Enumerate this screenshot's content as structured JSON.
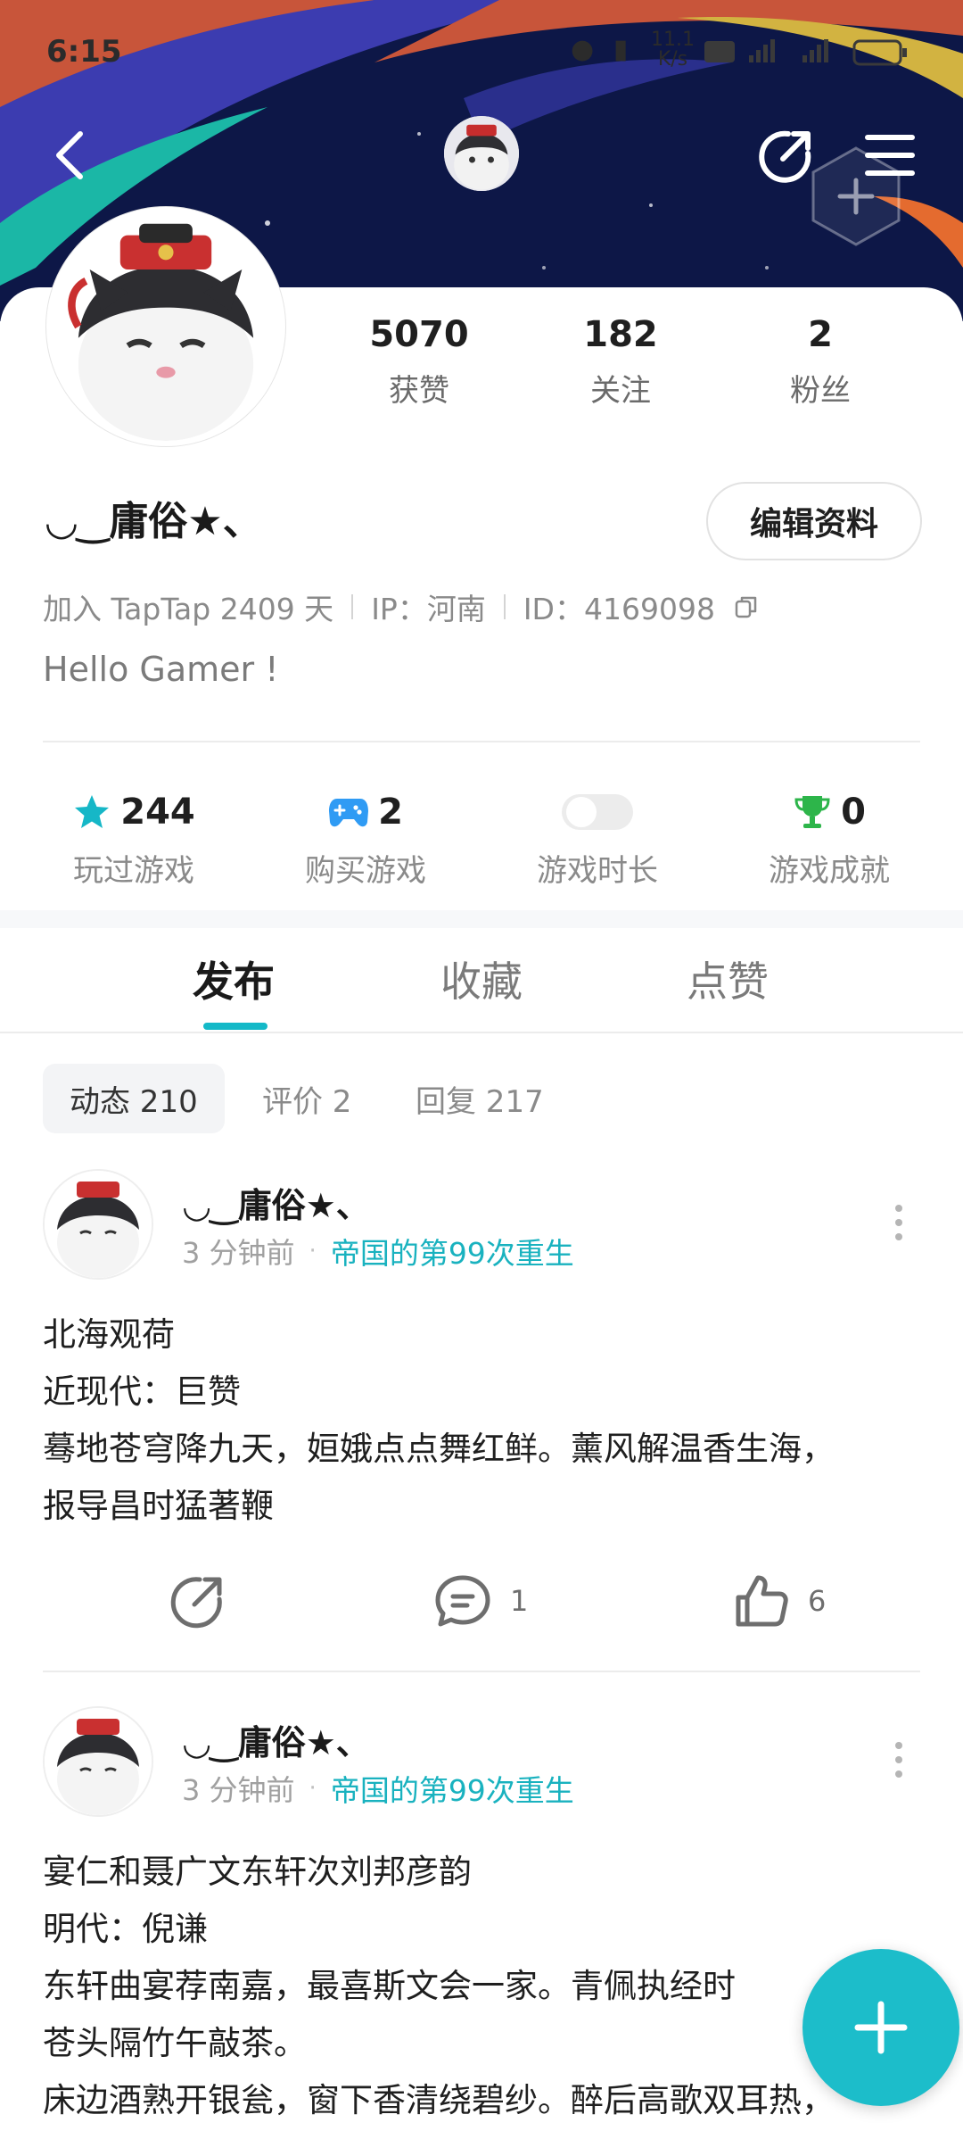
{
  "status_bar": {
    "time": "6:15",
    "net_speed": "11.1",
    "net_unit": "K/s"
  },
  "header": {
    "back_icon": "chevron-left-icon",
    "share_icon": "share-icon",
    "menu_icon": "menu-icon",
    "add_icon": "plus-icon"
  },
  "profile": {
    "stats": [
      {
        "value": "5070",
        "label": "获赞"
      },
      {
        "value": "182",
        "label": "关注"
      },
      {
        "value": "2",
        "label": "粉丝"
      }
    ],
    "username": "◡‿庸俗★、",
    "edit_label": "编辑资料",
    "joined": "加入 TapTap 2409 天",
    "ip": "IP：河南",
    "id": "ID：4169098",
    "bio": "Hello Gamer !"
  },
  "game_stats": [
    {
      "value": "244",
      "label": "玩过游戏",
      "icon": "star-icon",
      "color": "#16b7c7"
    },
    {
      "value": "2",
      "label": "购买游戏",
      "icon": "gamepad-icon",
      "color": "#2f9bf4"
    },
    {
      "value": "",
      "label": "游戏时长",
      "icon": "toggle-icon",
      "color": "#e6e6e6"
    },
    {
      "value": "0",
      "label": "游戏成就",
      "icon": "trophy-icon",
      "color": "#2db54a"
    }
  ],
  "tabs": [
    {
      "label": "发布"
    },
    {
      "label": "收藏"
    },
    {
      "label": "点赞"
    }
  ],
  "chips": [
    {
      "label": "动态 210"
    },
    {
      "label": "评价 2"
    },
    {
      "label": "回复 217"
    }
  ],
  "posts": [
    {
      "author": "◡‿庸俗★、",
      "time": "3 分钟前",
      "tag": "帝国的第99次重生",
      "lines": [
        "北海观荷",
        "近现代：巨赞",
        "蓦地苍穹降九天，姮娥点点舞红鲜。薰风解温香生海，",
        "报导昌时猛著鞭"
      ],
      "comments": "1",
      "likes": "6"
    },
    {
      "author": "◡‿庸俗★、",
      "time": "3 分钟前",
      "tag": "帝国的第99次重生",
      "lines": [
        "宴仁和聂广文东轩次刘邦彦韵",
        "明代：倪谦",
        "东轩曲宴荐南嘉，最喜斯文会一家。青佩执经时",
        "苍头隔竹午敲茶。",
        "床边酒熟开银瓮，窗下香清绕碧纱。醉后高歌双耳热，"
      ]
    }
  ],
  "colors": {
    "accent": "#16b7c7",
    "banner_bg": "#0f1b4f"
  }
}
